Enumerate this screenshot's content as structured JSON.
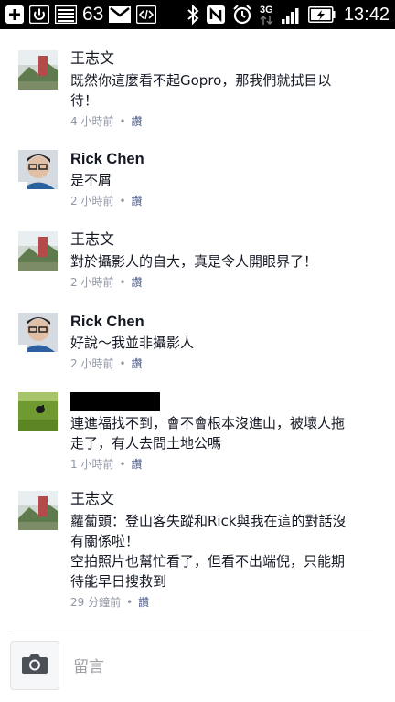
{
  "status_bar": {
    "left_icons": [
      "add-icon",
      "power-icon",
      "image-icon",
      "mail-icon",
      "code-icon"
    ],
    "notification_count": "63",
    "right_icons": [
      "bluetooth-icon",
      "nfc-icon",
      "alarm-icon",
      "3g-icon",
      "signal-icon",
      "battery-icon"
    ],
    "network": "3G",
    "time": "13:42"
  },
  "comments": [
    {
      "author": "王志文",
      "text": "既然你這麼看不起Gopro，那我們就拭目以\n待！",
      "time": "4 小時前",
      "like": "讚",
      "avatar": "landscape-avatar"
    },
    {
      "author": "Rick Chen",
      "text": "是不屑",
      "time": "2 小時前",
      "like": "讚",
      "avatar": "person-avatar"
    },
    {
      "author": "王志文",
      "text": "對於攝影人的自大，真是令人開眼界了！",
      "time": "2 小時前",
      "like": "讚",
      "avatar": "landscape-avatar"
    },
    {
      "author": "Rick Chen",
      "text": "好說～我並非攝影人",
      "time": "2 小時前",
      "like": "讚",
      "avatar": "person-avatar"
    },
    {
      "author": "",
      "author_redacted": true,
      "text": "連進福找不到，會不會根本沒進山，被壞人拖\n走了，有人去問土地公嗎",
      "time": "1 小時前",
      "like": "讚",
      "avatar": "grass-avatar"
    },
    {
      "author": "王志文",
      "text": "蘿蔔頭：登山客失蹤和Rick與我在這的對話沒\n有關係啦！\n空拍照片也幫忙看了，但看不出端倪，只能期\n待能早日搜救到",
      "time": "29 分鐘前",
      "like": "讚",
      "avatar": "landscape-avatar"
    }
  ],
  "composer": {
    "placeholder": "留言",
    "camera_icon": "camera-icon"
  }
}
